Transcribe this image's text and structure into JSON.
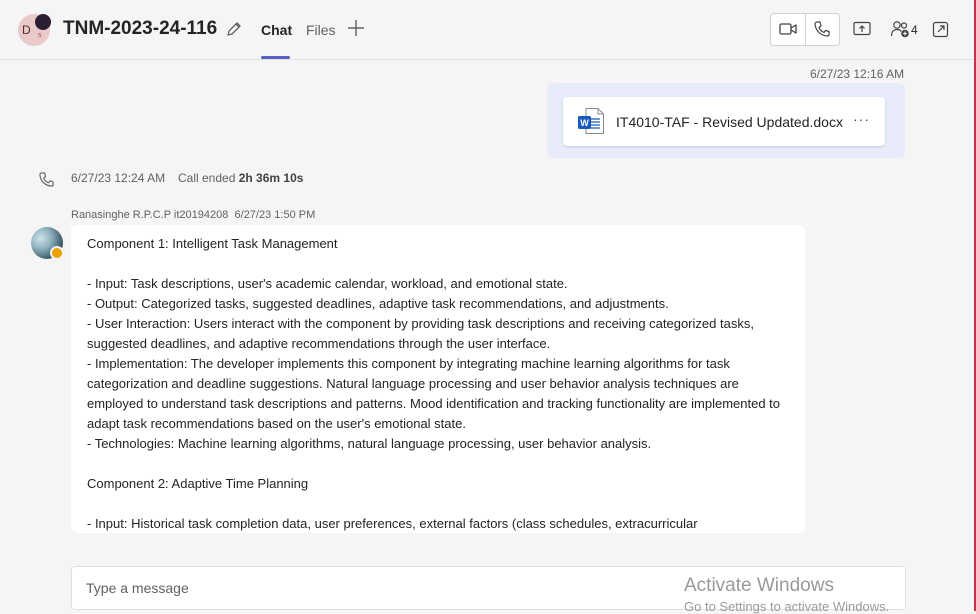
{
  "header": {
    "avatar_initial": "D",
    "avatar_sub": "s",
    "title": "TNM-2023-24-116",
    "tabs": [
      "Chat",
      "Files"
    ],
    "participants_count": "4"
  },
  "file_message": {
    "timestamp": "6/27/23 12:16 AM",
    "file_name": "IT4010-TAF - Revised Updated.docx",
    "more": "···"
  },
  "call_event": {
    "timestamp": "6/27/23 12:24 AM",
    "label": "Call ended",
    "duration": "2h 36m 10s"
  },
  "message": {
    "sender": "Ranasinghe R.P.C.P it20194208",
    "timestamp": "6/27/23 1:50 PM",
    "lines": [
      "Component 1: Intelligent Task Management",
      "",
      "- Input: Task descriptions, user's academic calendar, workload, and emotional state.",
      "- Output: Categorized tasks, suggested deadlines, adaptive task recommendations, and adjustments.",
      "- User Interaction: Users interact with the component by providing task descriptions and receiving categorized tasks, suggested deadlines, and adaptive recommendations through the user interface.",
      "- Implementation: The developer implements this component by integrating machine learning algorithms for task categorization and deadline suggestions. Natural language processing and user behavior analysis techniques are employed to understand task descriptions and patterns. Mood identification and tracking functionality are implemented to adapt task recommendations based on the user's emotional state.",
      "- Technologies: Machine learning algorithms, natural language processing, user behavior analysis.",
      "",
      "Component 2: Adaptive Time Planning",
      "",
      "- Input: Historical task completion data, user preferences, external factors (class schedules, extracurricular"
    ]
  },
  "compose": {
    "placeholder": "Type a message"
  },
  "watermark": {
    "line1": "Activate Windows",
    "line2": "Go to Settings to activate Windows."
  },
  "colors": {
    "accent": "#5b5fc7",
    "file_bubble": "#e8ebfa",
    "word_blue": "#185abd",
    "away_status": "#eaa300"
  }
}
